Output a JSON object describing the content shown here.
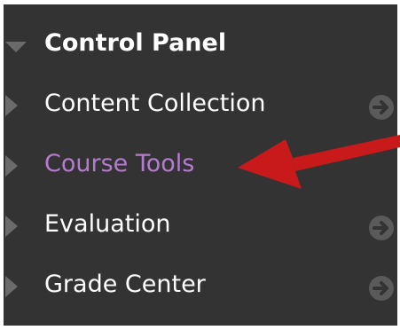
{
  "menu": {
    "header": {
      "label": "Control Panel",
      "icon": "chevron-down-icon"
    },
    "items": [
      {
        "label": "Content Collection",
        "icon": "chevron-right-icon",
        "has_go": true,
        "go_icon": "circle-arrow-right-icon",
        "active": false
      },
      {
        "label": "Course Tools",
        "icon": "chevron-right-icon",
        "has_go": false,
        "active": true
      },
      {
        "label": "Evaluation",
        "icon": "chevron-right-icon",
        "has_go": true,
        "go_icon": "circle-arrow-right-icon",
        "active": false
      },
      {
        "label": "Grade Center",
        "icon": "chevron-right-icon",
        "has_go": true,
        "go_icon": "circle-arrow-right-icon",
        "active": false
      }
    ]
  },
  "annotation": {
    "type": "red-arrow",
    "points_to": "Course Tools",
    "color": "#c8191b"
  },
  "colors": {
    "panel_bg": "#333333",
    "text": "#ffffff",
    "active_text": "#b77ad2",
    "chevron": "#6b6b6b",
    "go_icon_bg": "#5a5a5a",
    "go_icon_fg": "#333333"
  }
}
